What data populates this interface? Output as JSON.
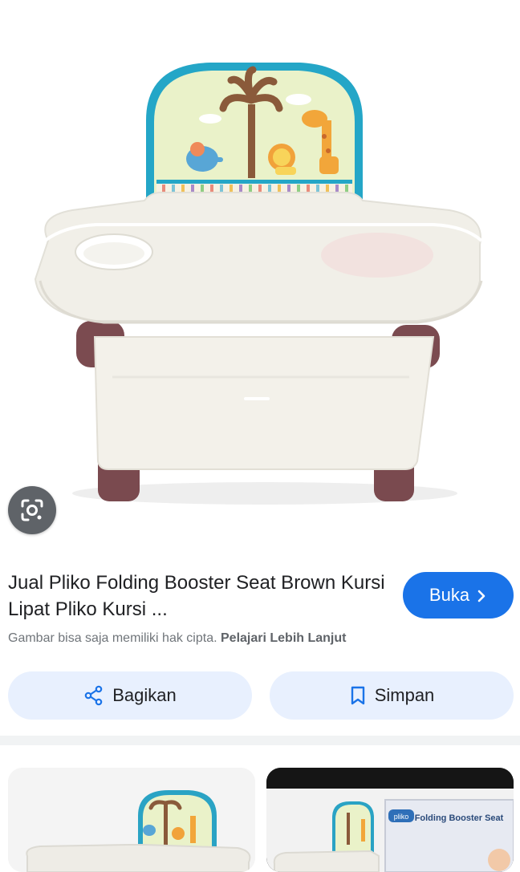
{
  "result": {
    "title": "Jual Pliko Folding Booster Seat Brown Kursi Lipat Pliko Kursi ...",
    "open_label": "Buka",
    "copyright_text": "Gambar bisa saja memiliki hak cipta.",
    "learn_more_label": "Pelajari Lebih Lanjut"
  },
  "actions": {
    "share_label": "Bagikan",
    "save_label": "Simpan"
  },
  "related": {
    "box_brand": "pliko",
    "box_title": "Folding Booster Seat"
  },
  "colors": {
    "accent": "#1a73e8",
    "pill_bg": "#e8f0fe"
  }
}
